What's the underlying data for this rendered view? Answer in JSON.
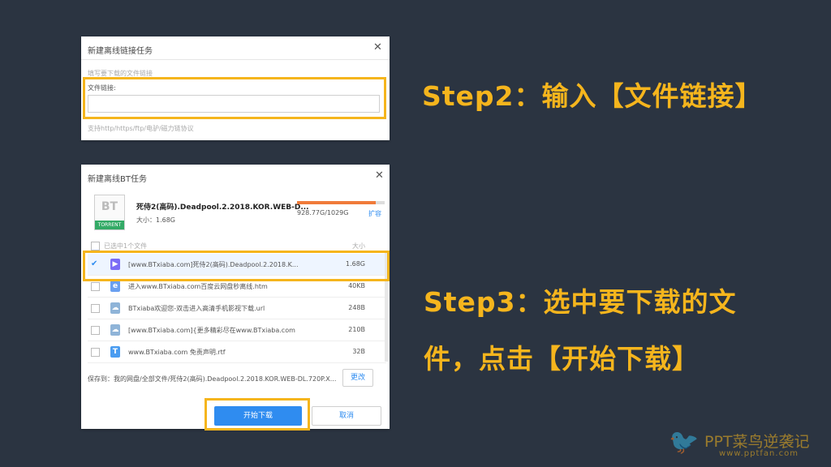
{
  "dialog1": {
    "title": "新建离线链接任务",
    "hint": "填写要下载的文件链接",
    "field_label": "文件链接:",
    "input_value": "",
    "protocols": "支持http/https/ftp/电驴/磁力链协议"
  },
  "dialog2": {
    "title": "新建离线BT任务",
    "torrent_icon_text": "BT",
    "torrent_icon_tag": "TORRENT",
    "file_title": "死侍2(高码).Deadpool.2.2018.KOR.WEB-D...",
    "total_size": "大小：1.68G",
    "storage_text": "928.77G/1029G",
    "storage_used_fraction": 0.9,
    "expand_link": "扩容",
    "list_header_selected": "已选中1个文件",
    "list_header_size": "大小",
    "files": [
      {
        "name": "[www.BTxiaba.com]死侍2(高码).Deadpool.2.2018.K...",
        "size": "1.68G",
        "checked": true,
        "icon": "video-file-icon",
        "glyph": "▶",
        "color": "#7b6cf6"
      },
      {
        "name": "进入www.BTxiaba.com百度云网盘秒离线.htm",
        "size": "40KB",
        "checked": false,
        "icon": "html-file-icon",
        "glyph": "e",
        "color": "#6aa0f0"
      },
      {
        "name": "BTxiaba欢迎您-双击进入高清手机影视下载.url",
        "size": "248B",
        "checked": false,
        "icon": "url-file-icon",
        "glyph": "☁",
        "color": "#8fb4d8"
      },
      {
        "name": "[www.BTxiaba.com]{更多精彩尽在www.BTxiaba.com",
        "size": "210B",
        "checked": false,
        "icon": "cloud-file-icon",
        "glyph": "☁",
        "color": "#8fb4d8"
      },
      {
        "name": "www.BTxiaba.com 免责声明.rtf",
        "size": "32B",
        "checked": false,
        "icon": "text-file-icon",
        "glyph": "T",
        "color": "#4a9cf0"
      }
    ],
    "save_to": "保存到：我的网盘/全部文件/死侍2(高码).Deadpool.2.2018.KOR.WEB-DL.720P.X...",
    "change_button": "更改",
    "start_button": "开始下载",
    "cancel_button": "取消"
  },
  "step2": "Step2：输入【文件链接】",
  "step3_line1": "Step3：选中要下载的文",
  "step3_line2": "件，点击【开始下载】",
  "watermark": {
    "brand": "PPT菜鸟逆袭记",
    "url": "www.pptfan.com"
  },
  "colors": {
    "background": "#2b3441",
    "highlight": "#f5b51d",
    "primary_button": "#2f8cf0",
    "progress": "#f07b3a"
  }
}
